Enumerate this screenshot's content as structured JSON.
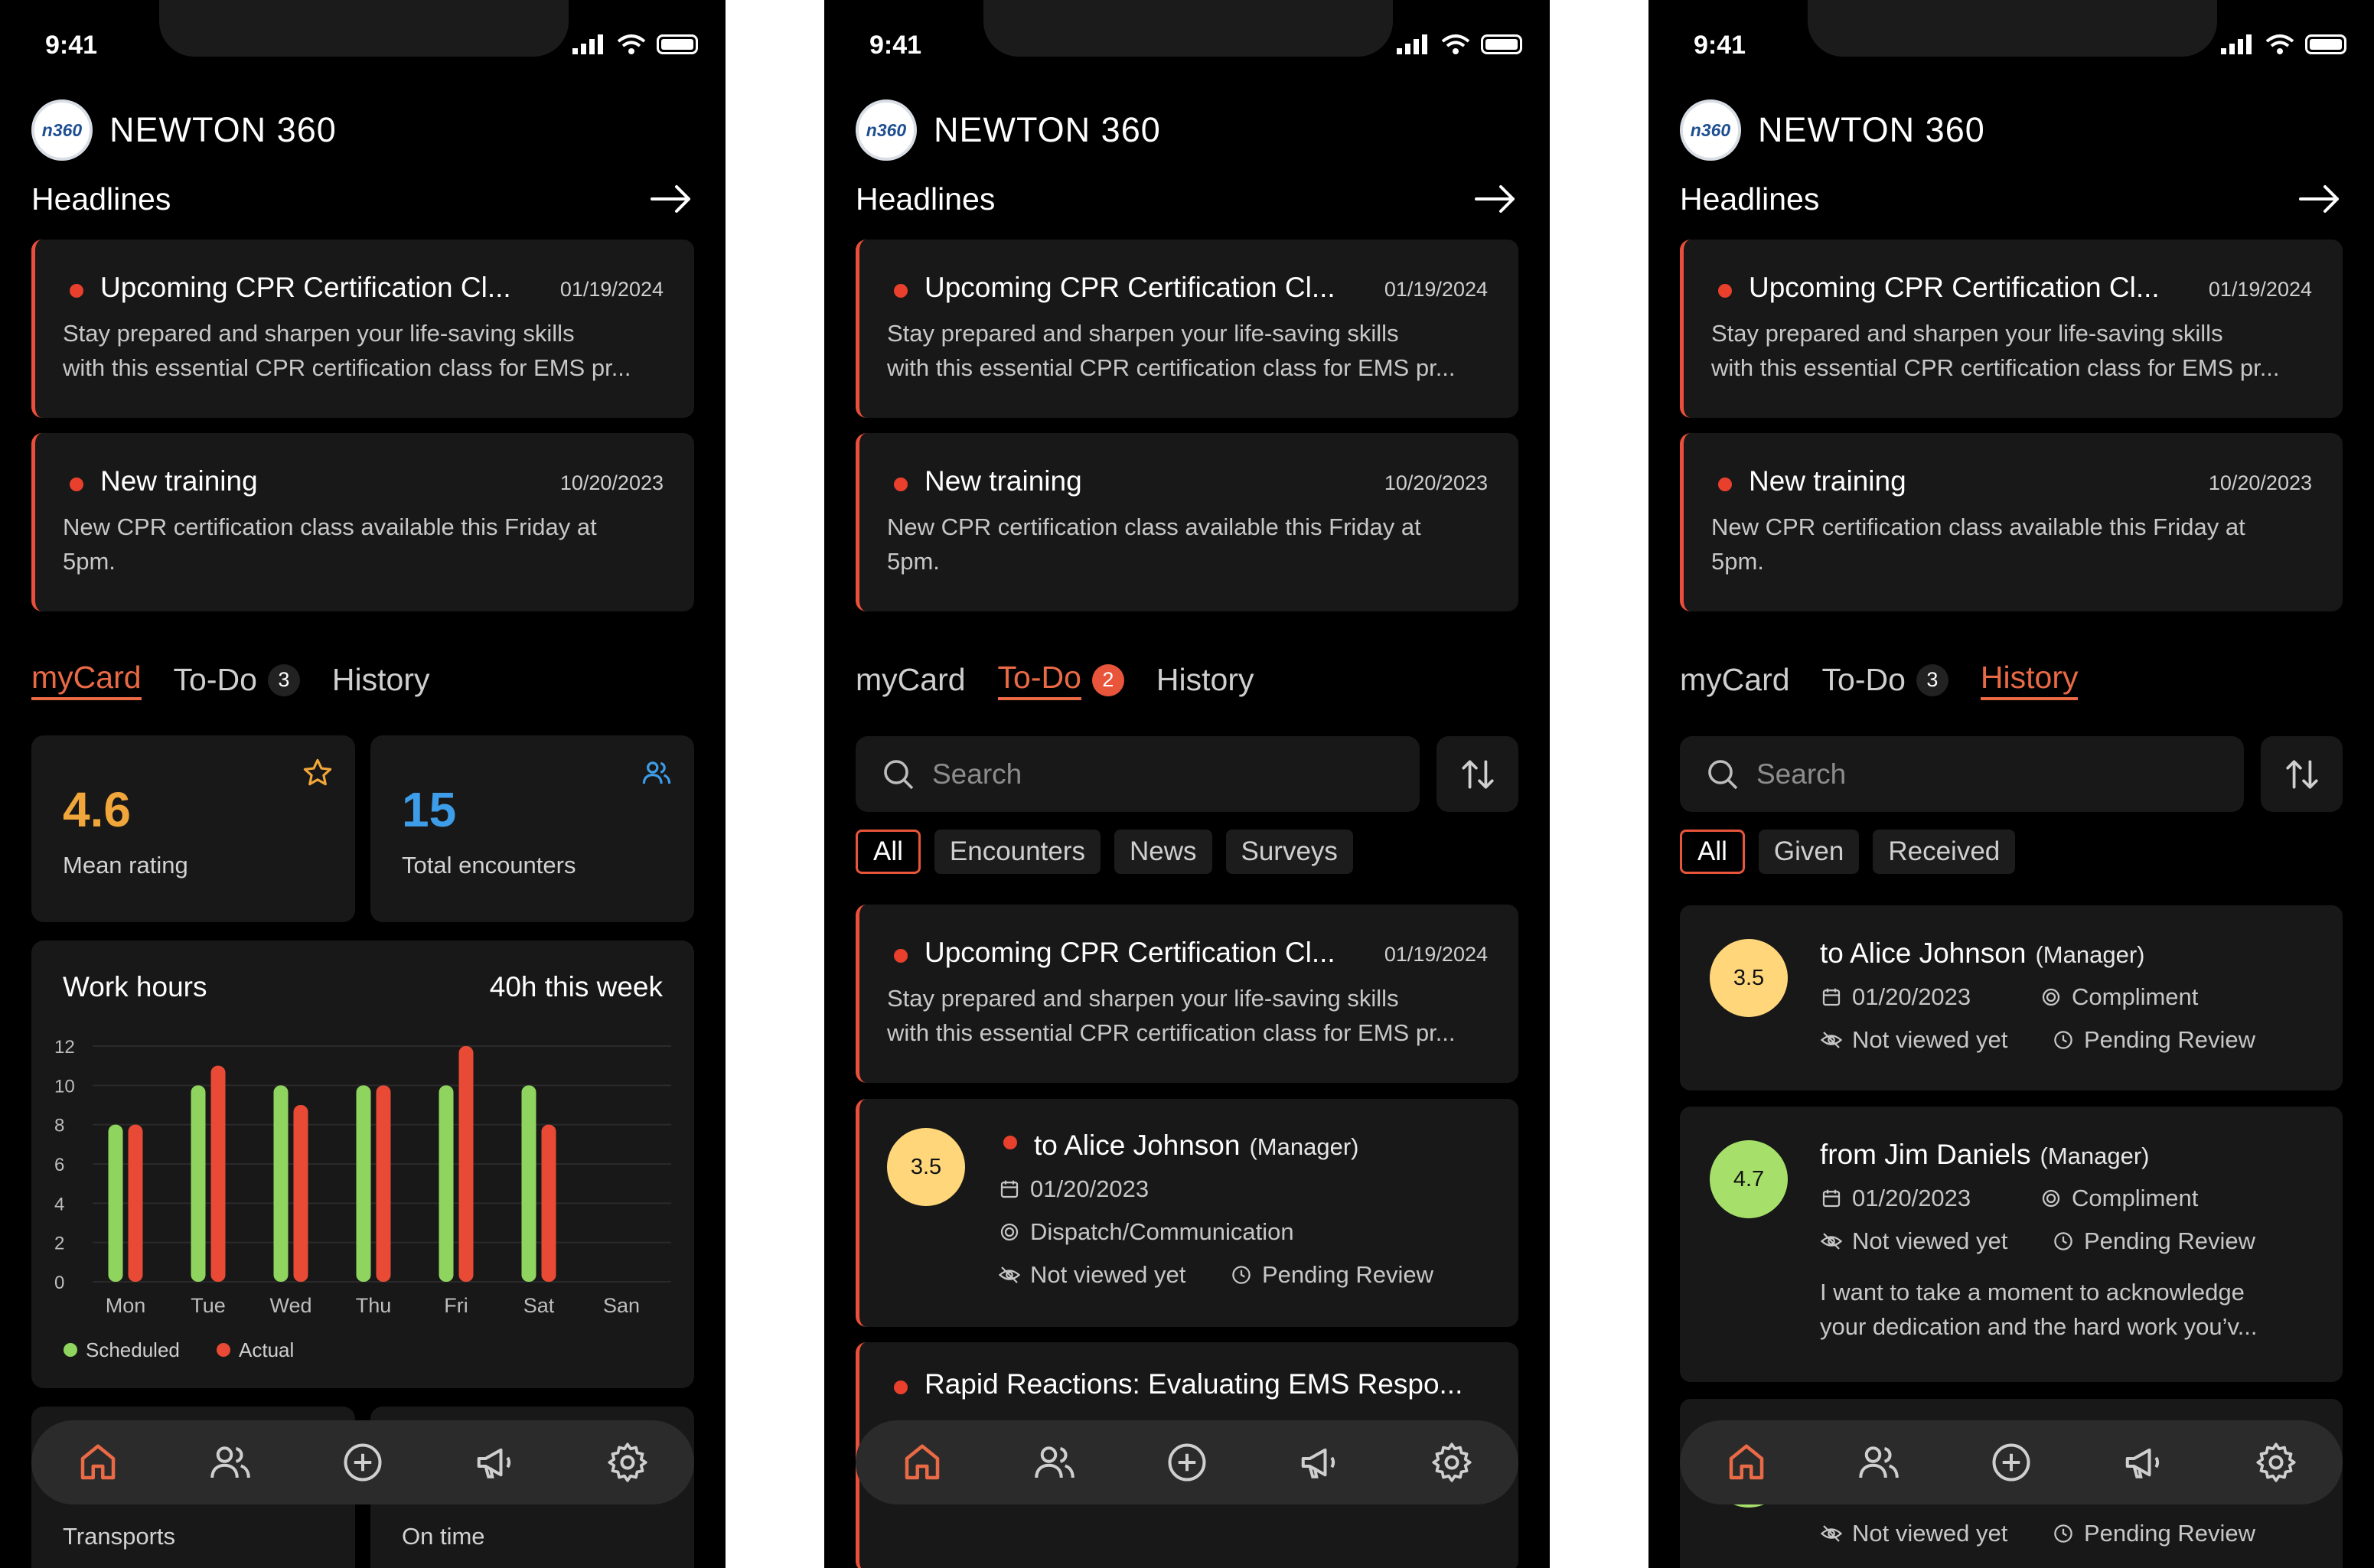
{
  "status_bar": {
    "time": "9:41"
  },
  "app": {
    "name": "NEWTON 360",
    "logo_text": "n360"
  },
  "headlines": {
    "title": "Headlines",
    "items": [
      {
        "title": "Upcoming CPR Certification Cl...",
        "date": "01/19/2024",
        "body_line1": "Stay prepared and sharpen your life-saving skills",
        "body_line2": "with this essential CPR certification class for EMS pr..."
      },
      {
        "title": "New training",
        "date": "10/20/2023",
        "body_line1": "New CPR certification class available this Friday at",
        "body_line2": "5pm."
      }
    ]
  },
  "tabs": {
    "mycard": "myCard",
    "todo": "To-Do",
    "history": "History",
    "todo_count_a": "3",
    "todo_count_b": "2",
    "todo_count_c": "3"
  },
  "mycard": {
    "rating": {
      "value": "4.6",
      "label": "Mean rating"
    },
    "encounters": {
      "value": "15",
      "label": "Total encounters"
    },
    "work_hours": {
      "title": "Work hours",
      "summary": "40h this week"
    },
    "bottom_labels": {
      "left": "Transports",
      "right": "On time"
    }
  },
  "chart_data": {
    "type": "bar",
    "title": "Work hours",
    "categories": [
      "Mon",
      "Tue",
      "Wed",
      "Thu",
      "Fri",
      "Sat",
      "San"
    ],
    "series": [
      {
        "name": "Scheduled",
        "color": "#8fd45f",
        "values": [
          8,
          10,
          10,
          10,
          10,
          10,
          0
        ]
      },
      {
        "name": "Actual",
        "color": "#e84a35",
        "values": [
          8,
          11,
          9,
          10,
          12,
          8,
          0
        ]
      }
    ],
    "ylim": [
      0,
      12
    ],
    "yticks": [
      "0",
      "2",
      "4",
      "6",
      "8",
      "10",
      "12"
    ],
    "grid": true,
    "legend_position": "bottom-left"
  },
  "search": {
    "placeholder": "Search"
  },
  "todo": {
    "filters": [
      "All",
      "Encounters",
      "News",
      "Surveys"
    ],
    "items": [
      {
        "title": "Upcoming CPR Certification Cl...",
        "date": "01/19/2024",
        "body_line1": "Stay prepared and sharpen your life-saving skills",
        "body_line2": "with this essential CPR certification class for EMS pr..."
      },
      {
        "score": "3.5",
        "title": "to Alice Johnson",
        "role": "(Manager)",
        "date": "01/20/2023",
        "category": "Dispatch/Communication",
        "viewed": "Not viewed yet",
        "status": "Pending Review"
      },
      {
        "title": "Rapid Reactions: Evaluating EMS Respo..."
      }
    ]
  },
  "history": {
    "filters": [
      "All",
      "Given",
      "Received"
    ],
    "items": [
      {
        "score": "3.5",
        "title": "to Alice Johnson",
        "role": "(Manager)",
        "date": "01/20/2023",
        "type": "Compliment",
        "viewed": "Not viewed yet",
        "status": "Pending Review"
      },
      {
        "score": "4.7",
        "title": "from Jim Daniels",
        "role": "(Manager)",
        "date": "01/20/2023",
        "type": "Compliment",
        "viewed": "Not viewed yet",
        "status": "Pending Review",
        "body_line1": "I want to take a moment to acknowledge",
        "body_line2": "your dedication and the hard work you’v..."
      },
      {
        "viewed": "Not viewed yet",
        "status": "Pending Review"
      }
    ]
  },
  "colors": {
    "accent": "#ea6a45",
    "alert_dot": "#e8402c",
    "rating": "#f0a63a",
    "encounters": "#3e9de8",
    "score_yellow": "#ffd77a",
    "score_green": "#a6e06a"
  }
}
